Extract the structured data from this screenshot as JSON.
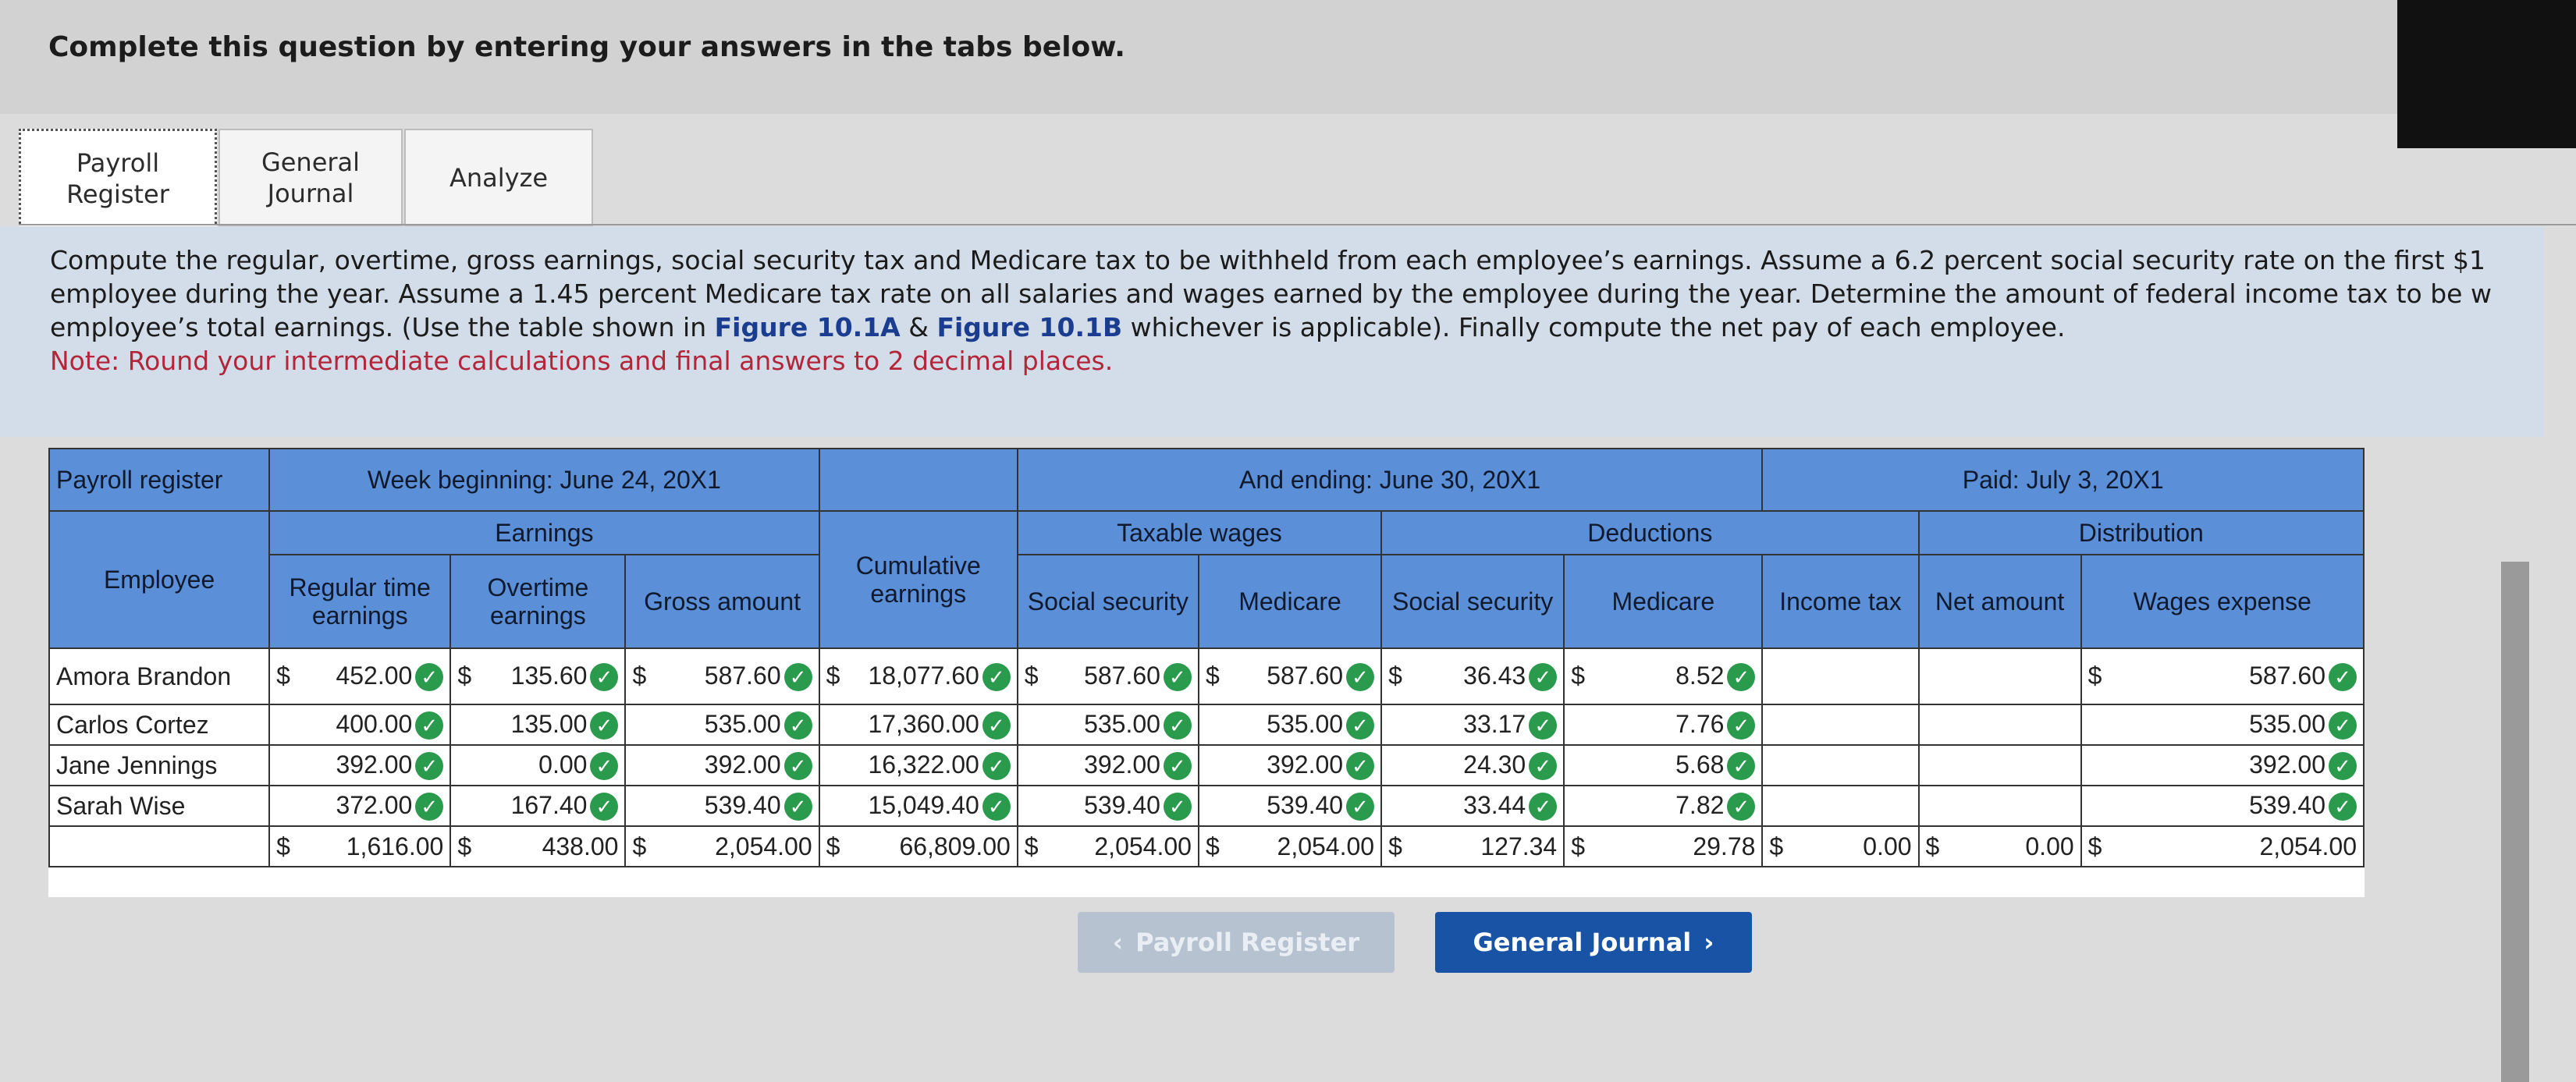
{
  "title": "Complete this question by entering your answers in the tabs below.",
  "tabs": [
    {
      "label": "Payroll\nRegister",
      "active": true
    },
    {
      "label": "General\nJournal",
      "active": false
    },
    {
      "label": "Analyze",
      "active": false
    }
  ],
  "instructions": {
    "line1": "Compute the regular, overtime, gross earnings, social security tax and Medicare tax to be withheld from each employee’s earnings. Assume a 6.2 percent social security rate on the first $1",
    "line2": "employee during the year. Assume a 1.45 percent Medicare tax rate on all salaries and wages earned by the employee during the year. Determine the amount of federal income tax to be w",
    "line3_pre": "employee’s total earnings. (Use the table shown in ",
    "fig_a": "Figure 10.1A",
    "amp": " & ",
    "fig_b": "Figure 10.1B",
    "line3_post": " whichever is applicable). Finally compute the net pay of each employee.",
    "note": "Note: Round your intermediate calculations and final answers to 2 decimal places."
  },
  "table": {
    "corner": "Payroll register",
    "week_beginning": "Week beginning: June 24, 20X1",
    "ending": "And ending: June 30, 20X1",
    "paid": "Paid: July 3, 20X1",
    "groups": {
      "earnings": "Earnings",
      "taxable": "Taxable wages",
      "deductions": "Deductions",
      "distribution": "Distribution"
    },
    "columns": {
      "employee": "Employee",
      "regular": "Regular time earnings",
      "overtime": "Overtime earnings",
      "gross": "Gross amount",
      "cumulative": "Cumulative earnings",
      "tw_ss": "Social security",
      "tw_med": "Medicare",
      "ded_ss": "Social security",
      "ded_med": "Medicare",
      "income_tax": "Income tax",
      "net": "Net amount",
      "wages": "Wages expense"
    },
    "dollar": "$",
    "rows": [
      {
        "name": "Amora Brandon",
        "regular": "452.00",
        "overtime": "135.60",
        "gross": "587.60",
        "cumulative": "18,077.60",
        "tw_ss": "587.60",
        "tw_med": "587.60",
        "ded_ss": "36.43",
        "ded_med": "8.52",
        "income_tax": "",
        "net": "",
        "wages": "587.60"
      },
      {
        "name": "Carlos Cortez",
        "regular": "400.00",
        "overtime": "135.00",
        "gross": "535.00",
        "cumulative": "17,360.00",
        "tw_ss": "535.00",
        "tw_med": "535.00",
        "ded_ss": "33.17",
        "ded_med": "7.76",
        "income_tax": "",
        "net": "",
        "wages": "535.00"
      },
      {
        "name": "Jane Jennings",
        "regular": "392.00",
        "overtime": "0.00",
        "gross": "392.00",
        "cumulative": "16,322.00",
        "tw_ss": "392.00",
        "tw_med": "392.00",
        "ded_ss": "24.30",
        "ded_med": "5.68",
        "income_tax": "",
        "net": "",
        "wages": "392.00"
      },
      {
        "name": "Sarah Wise",
        "regular": "372.00",
        "overtime": "167.40",
        "gross": "539.40",
        "cumulative": "15,049.40",
        "tw_ss": "539.40",
        "tw_med": "539.40",
        "ded_ss": "33.44",
        "ded_med": "7.82",
        "income_tax": "",
        "net": "",
        "wages": "539.40"
      }
    ],
    "totals": {
      "regular": "1,616.00",
      "overtime": "438.00",
      "gross": "2,054.00",
      "cumulative": "66,809.00",
      "tw_ss": "2,054.00",
      "tw_med": "2,054.00",
      "ded_ss": "127.34",
      "ded_med": "29.78",
      "income_tax": "0.00",
      "net": "0.00",
      "wages": "2,054.00"
    }
  },
  "buttons": {
    "prev": "Payroll Register",
    "next": "General Journal"
  },
  "icons": {
    "check": "check-circle-icon",
    "prev_arrow": "chevron-left-icon",
    "next_arrow": "chevron-right-icon"
  },
  "colors": {
    "header_blue": "#5b8fd8",
    "check_green": "#2a9a4c",
    "next_button": "#1953a6"
  }
}
